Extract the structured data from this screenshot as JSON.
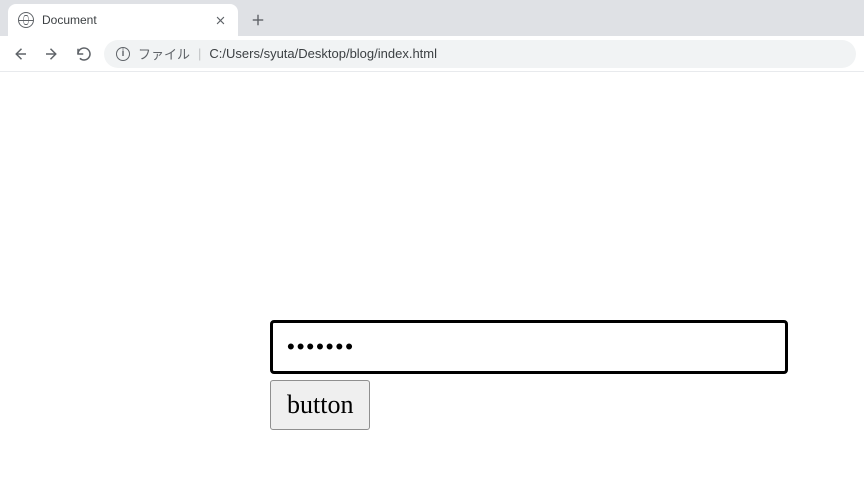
{
  "browser": {
    "tab": {
      "title": "Document"
    },
    "address": {
      "scheme_label": "ファイル",
      "url": "C:/Users/syuta/Desktop/blog/index.html"
    }
  },
  "form": {
    "password_value": "aaaaaaa",
    "button_label": "button"
  }
}
